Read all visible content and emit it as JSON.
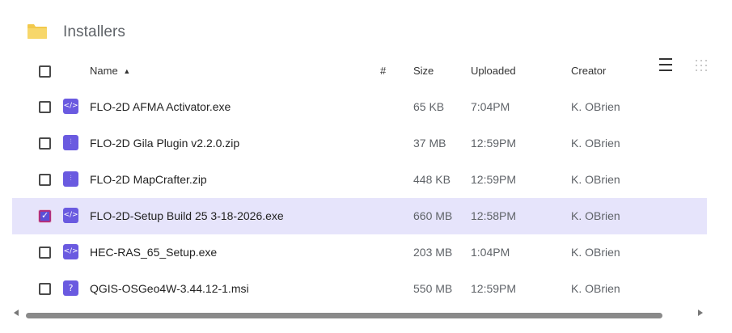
{
  "folder": {
    "title": "Installers",
    "icon": "folder-icon",
    "color": "#f2c94c"
  },
  "columns": {
    "name": "Name",
    "sort_indicator": "▲",
    "number": "#",
    "size": "Size",
    "uploaded": "Uploaded",
    "creator": "Creator"
  },
  "files": [
    {
      "name": "FLO-2D AFMA Activator.exe",
      "type_icon": "code-file-icon",
      "type_glyph": "</>",
      "size": "65 KB",
      "uploaded": "7:04PM",
      "creator": "K. OBrien",
      "selected": false
    },
    {
      "name": "FLO-2D Gila Plugin v2.2.0.zip",
      "type_icon": "zip-file-icon",
      "type_glyph": "⫶",
      "size": "37 MB",
      "uploaded": "12:59PM",
      "creator": "K. OBrien",
      "selected": false
    },
    {
      "name": "FLO-2D MapCrafter.zip",
      "type_icon": "zip-file-icon",
      "type_glyph": "⫶",
      "size": "448 KB",
      "uploaded": "12:59PM",
      "creator": "K. OBrien",
      "selected": false
    },
    {
      "name": "FLO-2D-Setup Build 25 3-18-2026.exe",
      "type_icon": "code-file-icon",
      "type_glyph": "</>",
      "size": "660 MB",
      "uploaded": "12:58PM",
      "creator": "K. OBrien",
      "selected": true
    },
    {
      "name": "HEC-RAS_65_Setup.exe",
      "type_icon": "code-file-icon",
      "type_glyph": "</>",
      "size": "203 MB",
      "uploaded": "1:04PM",
      "creator": "K. OBrien",
      "selected": false
    },
    {
      "name": "QGIS-OSGeo4W-3.44.12-1.msi",
      "type_icon": "unknown-file-icon",
      "type_glyph": "?",
      "size": "550 MB",
      "uploaded": "12:59PM",
      "creator": "K. OBrien",
      "selected": false
    }
  ],
  "colors": {
    "accent": "#6a5ae0",
    "selected_row": "#e6e4fb",
    "selected_checkbox_border": "#b0307f"
  }
}
